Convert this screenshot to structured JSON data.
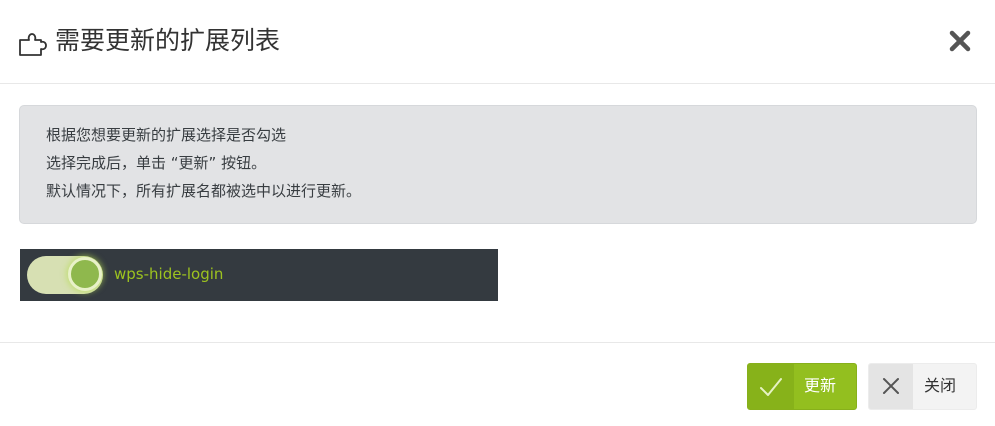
{
  "dialog": {
    "title": "需要更新的扩展列表",
    "header_icon": "puzzle-icon",
    "close_icon": "close-icon"
  },
  "info": {
    "lines": [
      "根据您想要更新的扩展选择是否勾选",
      "选择完成后，单击 “更新” 按钮。",
      "默认情况下，所有扩展名都被选中以进行更新。"
    ]
  },
  "extensions": [
    {
      "name": "wps-hide-login",
      "selected": true
    }
  ],
  "footer": {
    "update_label": "更新",
    "update_icon": "check-icon",
    "close_label": "关闭",
    "close_icon": "close-icon"
  },
  "colors": {
    "accent": "#93bf1f",
    "info_bg": "#e2e3e5",
    "row_bg": "#343a40",
    "ext_name": "#9dc31f"
  }
}
